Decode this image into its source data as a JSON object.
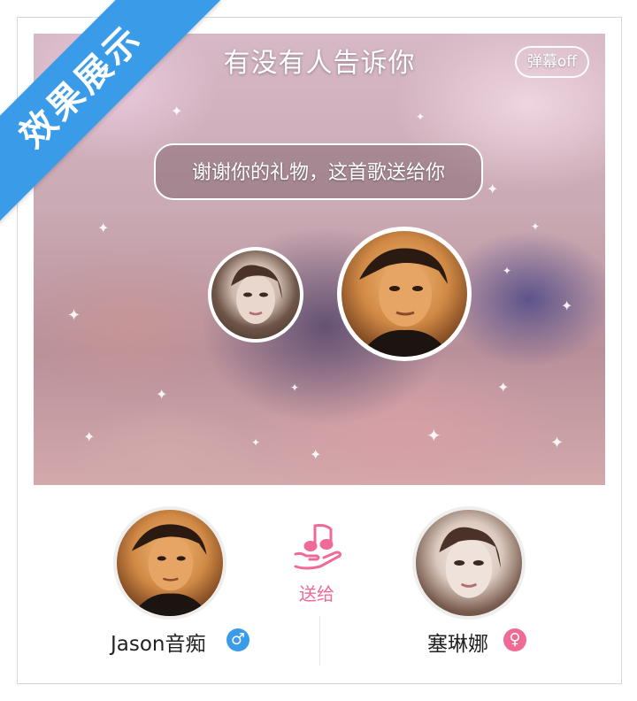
{
  "stage": {
    "song_title": "有没有人告诉你",
    "danmaku_toggle": "弹幕off",
    "bubble_text": "谢谢你的礼物，这首歌送给你"
  },
  "gift": {
    "action_label": "送给",
    "icon": "music-note-hand-icon",
    "accent_color": "#f06a96"
  },
  "sender": {
    "name": "Jason音痴",
    "gender_symbol": "♂",
    "gender_color": "#3a9be8"
  },
  "receiver": {
    "name": "塞琳娜",
    "gender_symbol": "♀",
    "gender_color": "#f06a96"
  },
  "ribbon": {
    "text": "效果展示",
    "color": "#3a9be8"
  }
}
